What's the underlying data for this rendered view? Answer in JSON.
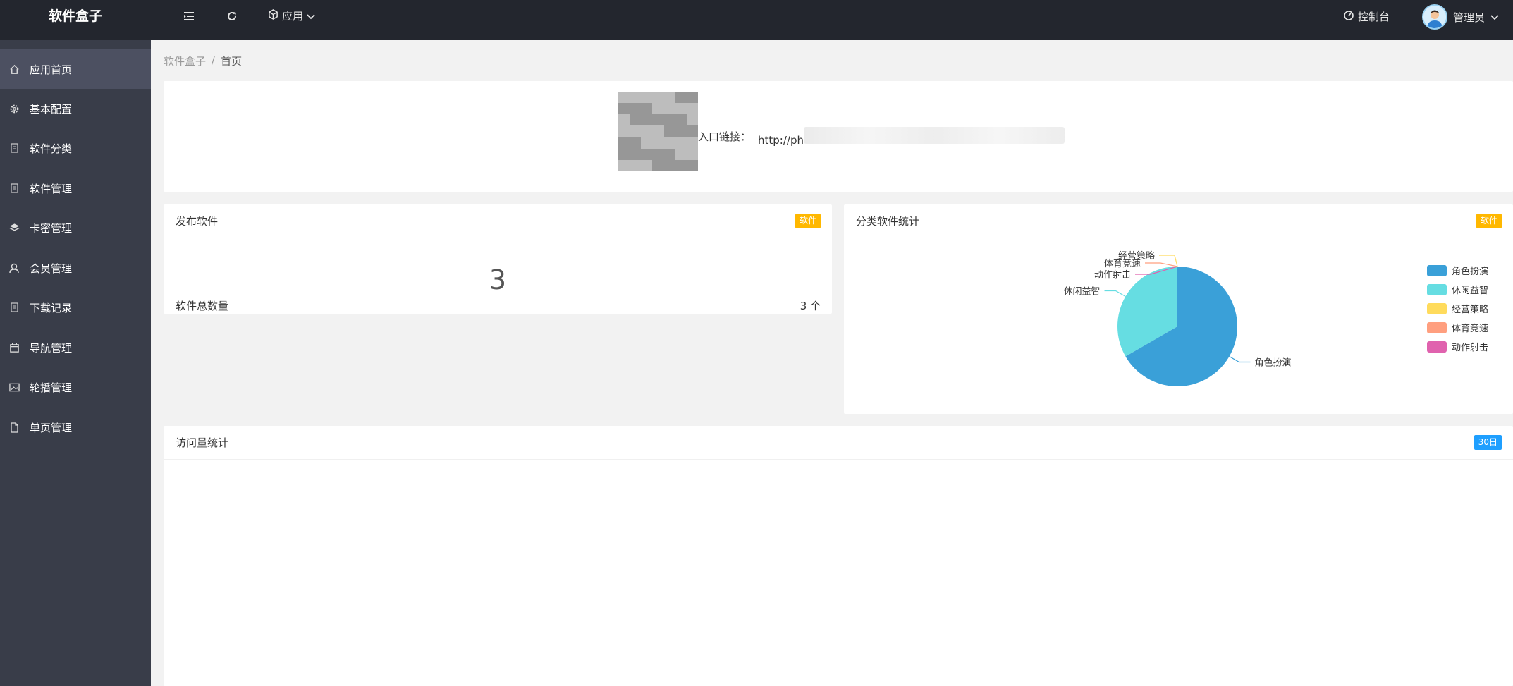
{
  "app": {
    "brand": "软件盒子"
  },
  "topbar": {
    "app_menu": "应用",
    "console": "控制台",
    "user": "管理员"
  },
  "sidebar": {
    "items": [
      {
        "label": "应用首页",
        "icon": "home-icon"
      },
      {
        "label": "基本配置",
        "icon": "gear-icon"
      },
      {
        "label": "软件分类",
        "icon": "file-icon"
      },
      {
        "label": "软件管理",
        "icon": "file-icon"
      },
      {
        "label": "卡密管理",
        "icon": "layers-icon"
      },
      {
        "label": "会员管理",
        "icon": "user-icon"
      },
      {
        "label": "下载记录",
        "icon": "file-icon"
      },
      {
        "label": "导航管理",
        "icon": "calendar-icon"
      },
      {
        "label": "轮播管理",
        "icon": "image-icon"
      },
      {
        "label": "单页管理",
        "icon": "page-icon"
      }
    ]
  },
  "breadcrumb": {
    "root": "软件盒子",
    "sep": "/",
    "current": "首页"
  },
  "entry": {
    "label": "入口链接：",
    "url": "http://ph"
  },
  "publish": {
    "title": "发布软件",
    "badge": "软件",
    "count": "3",
    "total_label": "软件总数量",
    "total_value": "3 个"
  },
  "category": {
    "title": "分类软件统计",
    "badge": "软件"
  },
  "visits": {
    "title": "访问量统计",
    "badge": "30日"
  },
  "chart_data": {
    "type": "pie",
    "series": [
      {
        "name": "角色扮演",
        "value": 2,
        "color": "#3aa0d8"
      },
      {
        "name": "休闲益智",
        "value": 1,
        "color": "#66dde2"
      },
      {
        "name": "经营策略",
        "value": 0,
        "color": "#ffdb5c"
      },
      {
        "name": "体育竞速",
        "value": 0,
        "color": "#ff9f7f"
      },
      {
        "name": "动作射击",
        "value": 0,
        "color": "#e062ae"
      }
    ],
    "legend_position": "right"
  }
}
